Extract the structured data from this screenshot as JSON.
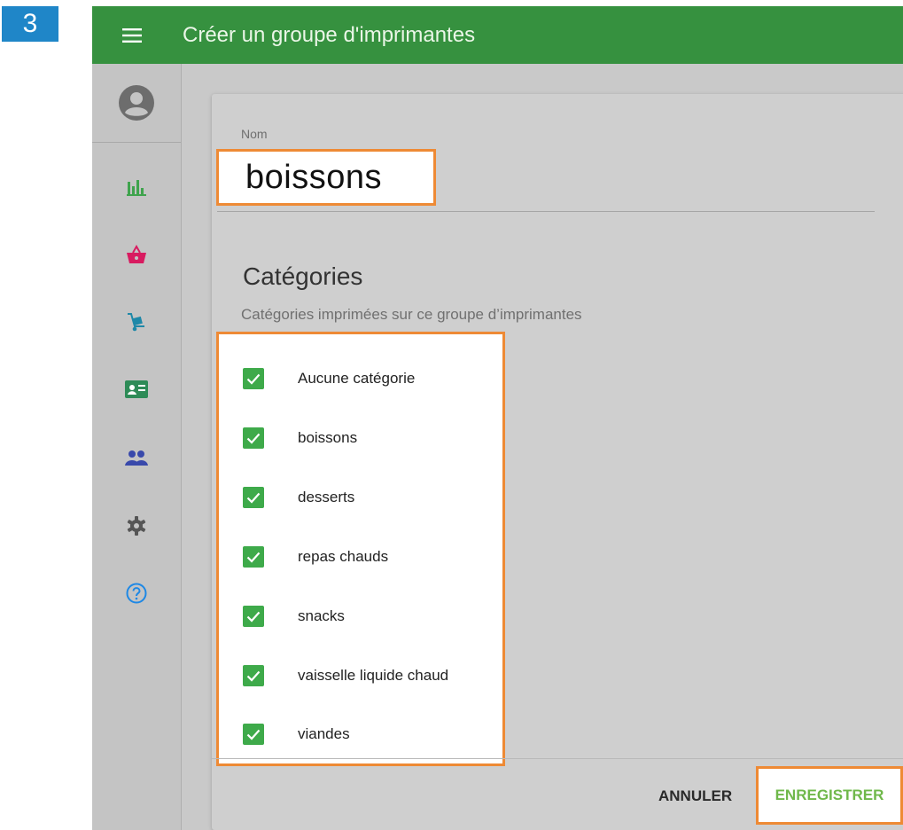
{
  "step_badge": "3",
  "header": {
    "title": "Créer un groupe d'imprimantes"
  },
  "sidebar": {
    "items": [
      {
        "icon": "bar-chart-icon",
        "color": "#3fa34d"
      },
      {
        "icon": "shopping-basket-icon",
        "color": "#d81b60"
      },
      {
        "icon": "hand-truck-icon",
        "color": "#1e88a8"
      },
      {
        "icon": "id-card-icon",
        "color": "#2e8b57"
      },
      {
        "icon": "people-icon",
        "color": "#3949ab"
      },
      {
        "icon": "gear-icon",
        "color": "#555555"
      },
      {
        "icon": "help-icon",
        "color": "#1e88e5"
      }
    ]
  },
  "form": {
    "name_label": "Nom",
    "name_value": "boissons",
    "categories_title": "Catégories",
    "categories_subtitle": "Catégories imprimées sur ce groupe d’imprimantes",
    "categories": [
      {
        "label": "Aucune catégorie",
        "checked": true
      },
      {
        "label": "boissons",
        "checked": true
      },
      {
        "label": "desserts",
        "checked": true
      },
      {
        "label": "repas chauds",
        "checked": true
      },
      {
        "label": "snacks",
        "checked": true
      },
      {
        "label": "vaisselle liquide chaud",
        "checked": true
      },
      {
        "label": "viandes",
        "checked": true
      }
    ]
  },
  "actions": {
    "cancel_label": "ANNULER",
    "save_label": "ENREGISTRER"
  },
  "colors": {
    "appbar": "#36913f",
    "highlight": "#ee8a35",
    "checkbox": "#3eaa4a",
    "save": "#6fb84a",
    "badge": "#1f86c8"
  }
}
